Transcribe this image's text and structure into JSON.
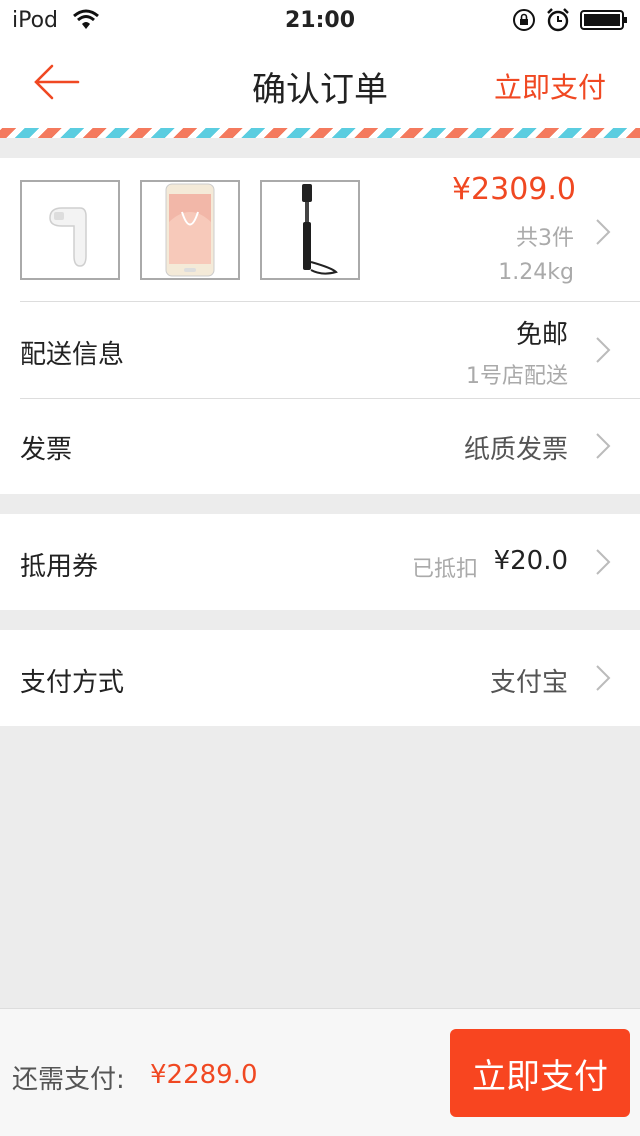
{
  "status_bar": {
    "carrier": "iPod",
    "time": "21:00"
  },
  "nav": {
    "title": "确认订单",
    "pay_link": "立即支付"
  },
  "order": {
    "price": "¥2309.0",
    "count": "共3件",
    "weight": "1.24kg",
    "products": [
      {
        "icon": "bluetooth-earphone-image"
      },
      {
        "icon": "smartphone-image"
      },
      {
        "icon": "selfie-stick-image"
      }
    ]
  },
  "delivery": {
    "label": "配送信息",
    "value": "免邮",
    "sub": "1号店配送"
  },
  "invoice": {
    "label": "发票",
    "value": "纸质发票"
  },
  "coupon": {
    "label": "抵用券",
    "hint": "已抵扣",
    "value": "¥20.0"
  },
  "payment": {
    "label": "支付方式",
    "value": "支付宝"
  },
  "footer": {
    "due_label": "还需支付:",
    "due_amount": "¥2289.0",
    "pay_button": "立即支付"
  },
  "colors": {
    "accent": "#f04822",
    "pay_button": "#f84520",
    "background": "#ececec"
  }
}
